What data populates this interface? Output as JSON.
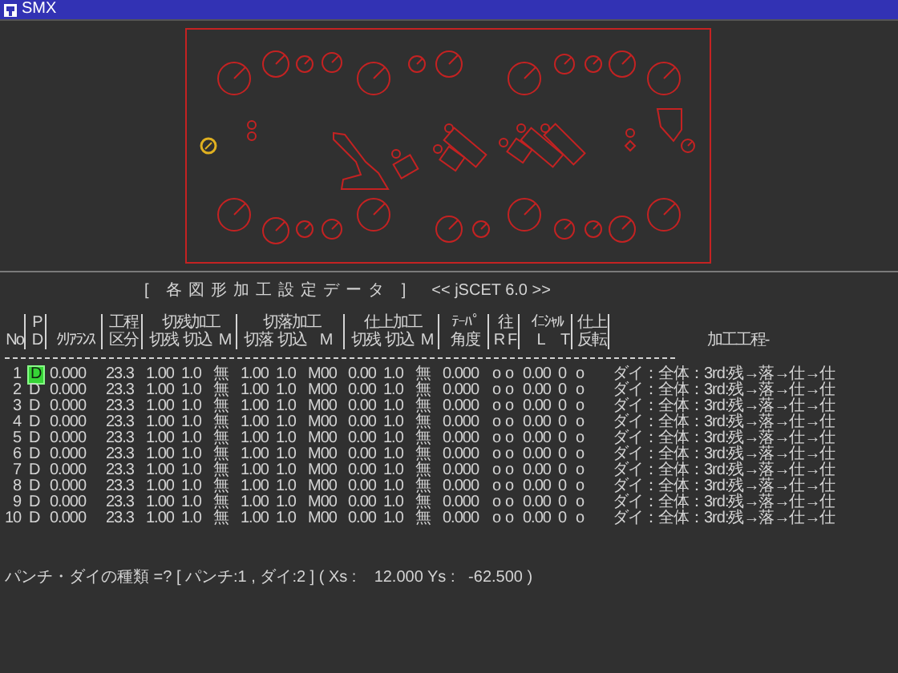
{
  "window": {
    "title": "SMX"
  },
  "heading": {
    "title": "[ 各図形加工設定データ ]",
    "version": "<< jSCET 6.0 >>"
  },
  "header": [
    {
      "sub": [
        "No"
      ]
    },
    {
      "top": "P",
      "sub": [
        "D"
      ]
    },
    {
      "sub": [
        "ｸﾘｱﾗﾝｽ"
      ]
    },
    {
      "top": "工程",
      "sub": [
        "区分"
      ]
    },
    {
      "top": "切残加工",
      "sub": [
        "切残",
        "切込",
        "M"
      ]
    },
    {
      "top": "切落加工",
      "sub": [
        "切落",
        "切込",
        "M"
      ]
    },
    {
      "top": "仕上加工",
      "sub": [
        "切残",
        "切込",
        "M"
      ]
    },
    {
      "top": "ﾃｰﾊﾟ",
      "sub": [
        "角度"
      ]
    },
    {
      "top": "往",
      "sub": [
        "R",
        "F"
      ]
    },
    {
      "top": "ｲﾆｼｬﾙ",
      "sub": [
        "L",
        "T"
      ]
    },
    {
      "top": "仕上",
      "sub": [
        "反転"
      ]
    },
    {
      "sub": [
        "加工工程-"
      ]
    }
  ],
  "rows": [
    {
      "selected": true,
      "cells": [
        "1",
        "D",
        "0.000",
        "23.3",
        "1.00",
        "1.0",
        "無",
        "1.00",
        "1.0",
        "M00",
        "0.00",
        "1.0",
        "無",
        "0.000",
        "o",
        "o",
        "0.00",
        "0",
        "o",
        "ダイ：全体：3rd:残→落→仕→仕"
      ]
    },
    {
      "selected": false,
      "cells": [
        "2",
        "D",
        "0.000",
        "23.3",
        "1.00",
        "1.0",
        "無",
        "1.00",
        "1.0",
        "M00",
        "0.00",
        "1.0",
        "無",
        "0.000",
        "o",
        "o",
        "0.00",
        "0",
        "o",
        "ダイ：全体：3rd:残→落→仕→仕"
      ]
    },
    {
      "selected": false,
      "cells": [
        "3",
        "D",
        "0.000",
        "23.3",
        "1.00",
        "1.0",
        "無",
        "1.00",
        "1.0",
        "M00",
        "0.00",
        "1.0",
        "無",
        "0.000",
        "o",
        "o",
        "0.00",
        "0",
        "o",
        "ダイ：全体：3rd:残→落→仕→仕"
      ]
    },
    {
      "selected": false,
      "cells": [
        "4",
        "D",
        "0.000",
        "23.3",
        "1.00",
        "1.0",
        "無",
        "1.00",
        "1.0",
        "M00",
        "0.00",
        "1.0",
        "無",
        "0.000",
        "o",
        "o",
        "0.00",
        "0",
        "o",
        "ダイ：全体：3rd:残→落→仕→仕"
      ]
    },
    {
      "selected": false,
      "cells": [
        "5",
        "D",
        "0.000",
        "23.3",
        "1.00",
        "1.0",
        "無",
        "1.00",
        "1.0",
        "M00",
        "0.00",
        "1.0",
        "無",
        "0.000",
        "o",
        "o",
        "0.00",
        "0",
        "o",
        "ダイ：全体：3rd:残→落→仕→仕"
      ]
    },
    {
      "selected": false,
      "cells": [
        "6",
        "D",
        "0.000",
        "23.3",
        "1.00",
        "1.0",
        "無",
        "1.00",
        "1.0",
        "M00",
        "0.00",
        "1.0",
        "無",
        "0.000",
        "o",
        "o",
        "0.00",
        "0",
        "o",
        "ダイ：全体：3rd:残→落→仕→仕"
      ]
    },
    {
      "selected": false,
      "cells": [
        "7",
        "D",
        "0.000",
        "23.3",
        "1.00",
        "1.0",
        "無",
        "1.00",
        "1.0",
        "M00",
        "0.00",
        "1.0",
        "無",
        "0.000",
        "o",
        "o",
        "0.00",
        "0",
        "o",
        "ダイ：全体：3rd:残→落→仕→仕"
      ]
    },
    {
      "selected": false,
      "cells": [
        "8",
        "D",
        "0.000",
        "23.3",
        "1.00",
        "1.0",
        "無",
        "1.00",
        "1.0",
        "M00",
        "0.00",
        "1.0",
        "無",
        "0.000",
        "o",
        "o",
        "0.00",
        "0",
        "o",
        "ダイ：全体：3rd:残→落→仕→仕"
      ]
    },
    {
      "selected": false,
      "cells": [
        "9",
        "D",
        "0.000",
        "23.3",
        "1.00",
        "1.0",
        "無",
        "1.00",
        "1.0",
        "M00",
        "0.00",
        "1.0",
        "無",
        "0.000",
        "o",
        "o",
        "0.00",
        "0",
        "o",
        "ダイ：全体：3rd:残→落→仕→仕"
      ]
    },
    {
      "selected": false,
      "cells": [
        "10",
        "D",
        "0.000",
        "23.3",
        "1.00",
        "1.0",
        "無",
        "1.00",
        "1.0",
        "M00",
        "0.00",
        "1.0",
        "無",
        "0.000",
        "o",
        "o",
        "0.00",
        "0",
        "o",
        "ダイ：全体：3rd:残→落→仕→仕"
      ]
    }
  ],
  "prompt": "パンチ・ダイの種類 =? [ パンチ:1 , ダイ:2 ] ( Xs :    12.000 Ys :   -62.500 )"
}
